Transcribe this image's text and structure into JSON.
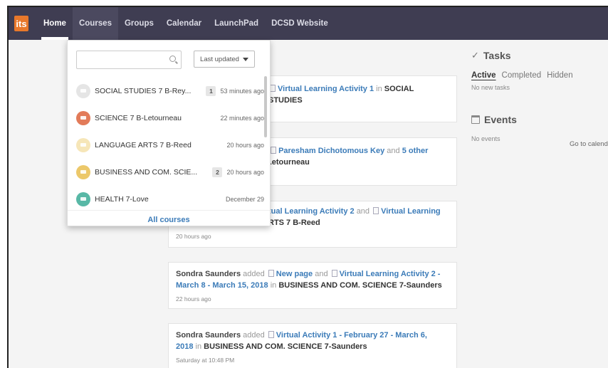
{
  "nav": {
    "logo": "its",
    "items": [
      "Home",
      "Courses",
      "Groups",
      "Calendar",
      "LaunchPad",
      "DCSD Website"
    ]
  },
  "dropdown": {
    "search_placeholder": "",
    "sort_label": "Last updated",
    "courses": [
      {
        "name": "SOCIAL STUDIES 7 B-Rey...",
        "badge": "1",
        "time": "53 minutes ago",
        "color": "#e5e5e5"
      },
      {
        "name": "SCIENCE 7 B-Letourneau",
        "badge": "",
        "time": "22 minutes ago",
        "color": "#e27b59"
      },
      {
        "name": "LANGUAGE ARTS 7 B-Reed",
        "badge": "",
        "time": "20 hours ago",
        "color": "#f6e6b8"
      },
      {
        "name": "BUSINESS AND COM. SCIE...",
        "badge": "2",
        "time": "20 hours ago",
        "color": "#ecc86a"
      },
      {
        "name": "HEALTH 7-Love",
        "badge": "",
        "time": "December 29",
        "color": "#58b8a6"
      }
    ],
    "all_courses_label": "All courses"
  },
  "feed": {
    "card1": {
      "link": "Virtual Learning Activity 1",
      "in": "in",
      "course": "SOCIAL STUDIES"
    },
    "card2": {
      "link1": "Paresham Dichotomous Key",
      "and": "and",
      "link2": "5 other",
      "course": "Letourneau"
    },
    "card3": {
      "link1": "tual Learning Activity 2",
      "and": "and",
      "link2": "Virtual Learning",
      "course": "RTS 7 B-Reed",
      "time": "20 hours ago"
    },
    "card4": {
      "who": "Sondra Saunders",
      "verb": "added",
      "link1": "New page",
      "and": "and",
      "link2": "Virtual Learning Activity 2 -",
      "link2b": "March 8 - March 15, 2018",
      "in": "in",
      "course": "BUSINESS AND COM. SCIENCE 7-Saunders",
      "time": "22 hours ago"
    },
    "card5": {
      "who": "Sondra Saunders",
      "verb": "added",
      "link1": "Virtual Activity 1 - February 27 - March 6,",
      "link1b": "2018",
      "in": "in",
      "course": "BUSINESS AND COM. SCIENCE 7-Saunders",
      "time": "Saturday at 10:48 PM"
    }
  },
  "tasks": {
    "title": "Tasks",
    "tabs": [
      "Active",
      "Completed",
      "Hidden"
    ],
    "empty": "No new tasks"
  },
  "events": {
    "title": "Events",
    "go_to_calendar": "Go to calend",
    "empty": "No events"
  },
  "colors": {
    "topbar": "#3f3d52",
    "link": "#3b7bb8",
    "logo": "#e8782b"
  }
}
